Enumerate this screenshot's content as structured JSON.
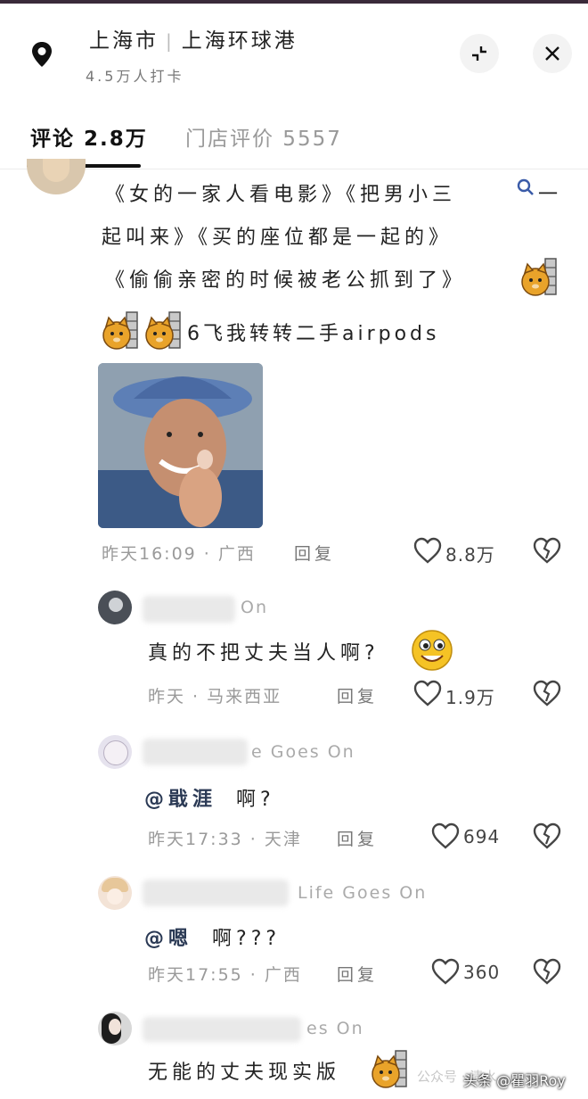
{
  "header": {
    "city": "上海市",
    "place": "上海环球港",
    "checkins": "4.5万人打卡"
  },
  "tabs": [
    {
      "label": "评论 2.8万",
      "active": true
    },
    {
      "label": "门店评价 5557",
      "active": false
    }
  ],
  "comments": [
    {
      "lines": [
        "《女的一家人看电影》《把男小三",
        "起叫来》《买的座位都是一起的》",
        "《偷偷亲密的时候被老公抓到了》"
      ],
      "search_link": "小三",
      "line4": "6飞我转转二手airpods",
      "time": "昨天16:09 · 广西",
      "reply": "回复",
      "likes": "8.8万"
    },
    {
      "user_suffix": "On",
      "text": "真的不把丈夫当人啊?",
      "time": "昨天 · 马来西亚",
      "reply": "回复",
      "likes": "1.9万"
    },
    {
      "user_suffix": "e Goes On",
      "mention": "@戢涯",
      "text": "啊?",
      "time": "昨天17:33 · 天津",
      "reply": "回复",
      "likes": "694"
    },
    {
      "user_suffix": "Life Goes On",
      "mention": "@嗯",
      "text": "啊???",
      "time": "昨天17:55 · 广西",
      "reply": "回复",
      "likes": "360"
    },
    {
      "user_suffix": "es On",
      "text": "无能的丈夫现实版"
    }
  ],
  "watermark": "头条 @瞿羽Roy",
  "watermark_bg": "公众号 · 清水"
}
